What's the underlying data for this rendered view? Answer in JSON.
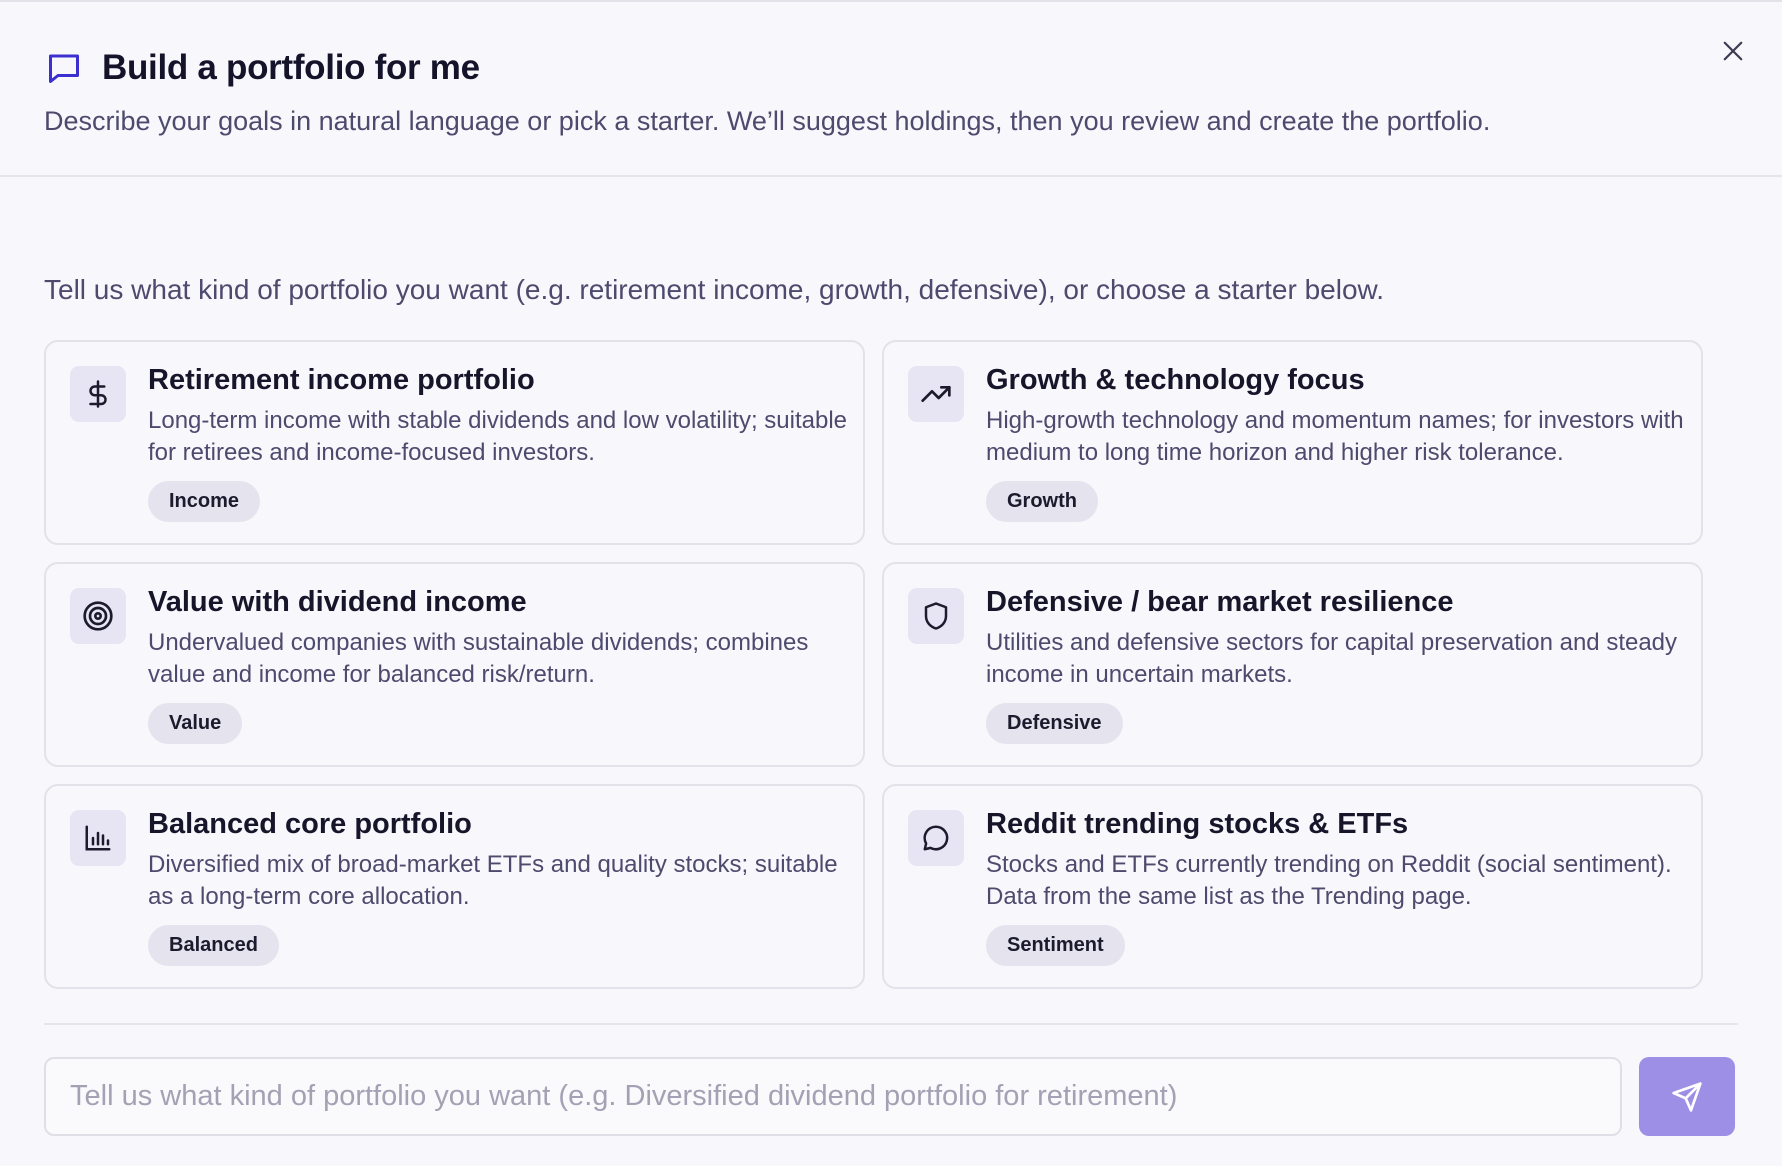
{
  "header": {
    "title": "Build a portfolio for me",
    "subtitle": "Describe your goals in natural language or pick a starter. We’ll suggest holdings, then you review and create the portfolio.",
    "title_icon": "message-square-icon",
    "close_icon": "close-icon"
  },
  "intro": "Tell us what kind of portfolio you want (e.g. retirement income, growth, defensive), or choose a starter below.",
  "starters": [
    {
      "icon": "dollar-icon",
      "title": "Retirement income portfolio",
      "description": "Long-term income with stable dividends and low volatility; suitable for retirees and income-focused investors.",
      "tag": "Income"
    },
    {
      "icon": "trending-up-icon",
      "title": "Growth & technology focus",
      "description": "High-growth technology and momentum names; for investors with medium to long time horizon and higher risk tolerance.",
      "tag": "Growth"
    },
    {
      "icon": "target-icon",
      "title": "Value with dividend income",
      "description": "Undervalued companies with sustainable dividends; combines value and income for balanced risk/return.",
      "tag": "Value"
    },
    {
      "icon": "shield-icon",
      "title": "Defensive / bear market resilience",
      "description": "Utilities and defensive sectors for capital preservation and steady income in uncertain markets.",
      "tag": "Defensive"
    },
    {
      "icon": "bar-chart-icon",
      "title": "Balanced core portfolio",
      "description": "Diversified mix of broad-market ETFs and quality stocks; suitable as a long-term core allocation.",
      "tag": "Balanced"
    },
    {
      "icon": "message-circle-icon",
      "title": "Reddit trending stocks & ETFs",
      "description": "Stocks and ETFs currently trending on Reddit (social sentiment). Data from the same list as the Trending page.",
      "tag": "Sentiment"
    }
  ],
  "composer": {
    "placeholder": "Tell us what kind of portfolio you want (e.g. Diversified dividend portfolio for retirement)",
    "value": "",
    "send_icon": "send-icon"
  },
  "colors": {
    "accent": "#9e8fe6",
    "icon_bg": "#e7e5f3",
    "title_icon": "#3b2fd1"
  }
}
